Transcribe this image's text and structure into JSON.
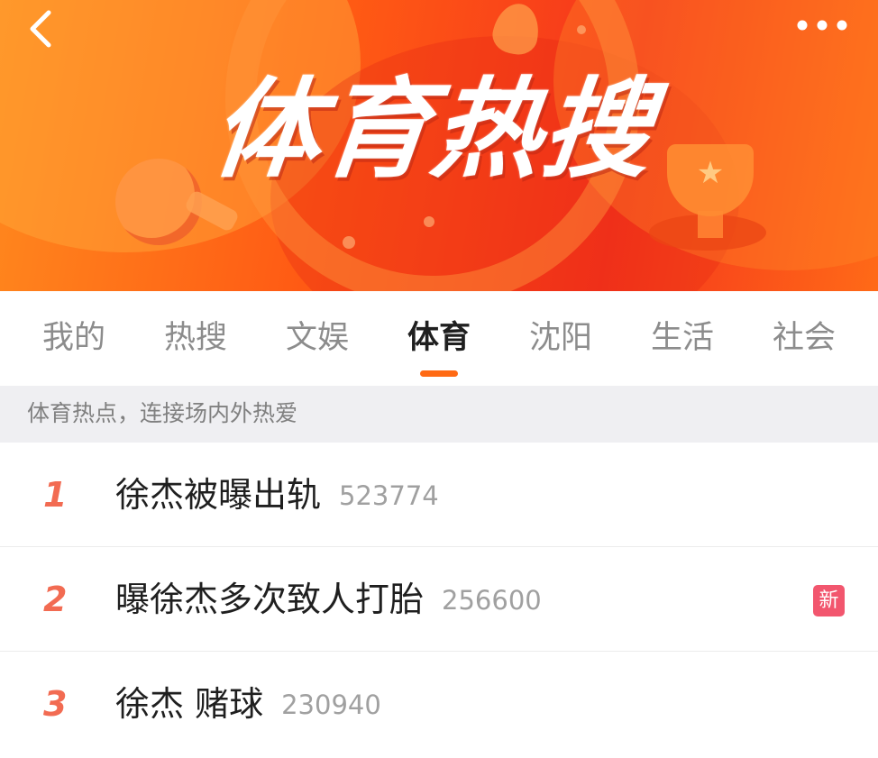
{
  "header": {
    "title": "体育热搜",
    "back_icon": "chevron-left-icon",
    "more_icon": "ellipsis-icon"
  },
  "tabs": [
    {
      "label": "我的",
      "active": false
    },
    {
      "label": "热搜",
      "active": false
    },
    {
      "label": "文娱",
      "active": false
    },
    {
      "label": "体育",
      "active": true
    },
    {
      "label": "沈阳",
      "active": false
    },
    {
      "label": "生活",
      "active": false
    },
    {
      "label": "社会",
      "active": false
    }
  ],
  "subheader": {
    "text": "体育热点，连接场内外热爱"
  },
  "list": [
    {
      "rank": "1",
      "title": "徐杰被曝出轨",
      "count": "523774",
      "badge": ""
    },
    {
      "rank": "2",
      "title": "曝徐杰多次致人打胎",
      "count": "256600",
      "badge": "新"
    },
    {
      "rank": "3",
      "title": "徐杰 赌球",
      "count": "230940",
      "badge": ""
    }
  ],
  "colors": {
    "accent": "#ff6a14",
    "rank": "#f26b52",
    "new_badge": "#f2566e",
    "banner_start": "#ff8a1e",
    "banner_end": "#f5341c"
  }
}
